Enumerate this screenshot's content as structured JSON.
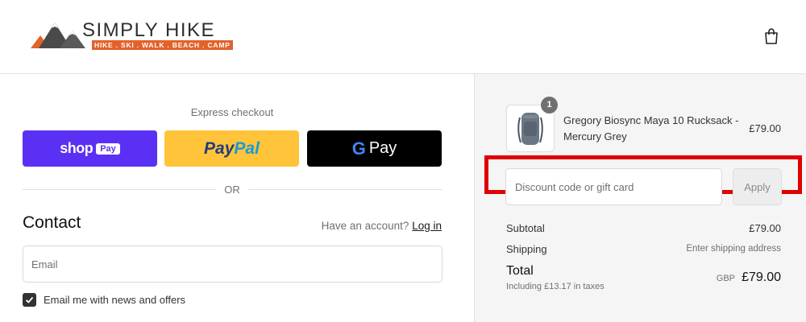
{
  "header": {
    "brand_name": "SIMPLY HIKE",
    "brand_tagline": "HIKE . SKI . WALK . BEACH . CAMP",
    "bag_icon": "shopping-bag-icon"
  },
  "express": {
    "title": "Express checkout",
    "shop_word": "shop",
    "shop_pay": "Pay",
    "paypal_a": "Pay",
    "paypal_b": "Pal",
    "gpay_g": "G",
    "gpay_pay": "Pay",
    "or_text": "OR"
  },
  "contact": {
    "title": "Contact",
    "account_prompt": "Have an account?",
    "login_label": "Log in",
    "email_placeholder": "Email",
    "newsletter_label": "Email me with news and offers",
    "newsletter_checked": true
  },
  "cart": {
    "item": {
      "name": "Gregory Biosync Maya 10 Rucksack - Mercury Grey",
      "price": "£79.00",
      "quantity": "1"
    },
    "discount_placeholder": "Discount code or gift card",
    "apply_label": "Apply",
    "subtotal_label": "Subtotal",
    "subtotal_value": "£79.00",
    "shipping_label": "Shipping",
    "shipping_value": "Enter shipping address",
    "total_label": "Total",
    "tax_note": "Including £13.17 in taxes",
    "currency": "GBP",
    "total_value": "£79.00"
  },
  "colors": {
    "shop_pay": "#5a31f4",
    "paypal": "#ffc439",
    "gpay": "#000000",
    "highlight": "#e00000",
    "brand_orange": "#e2622a"
  }
}
